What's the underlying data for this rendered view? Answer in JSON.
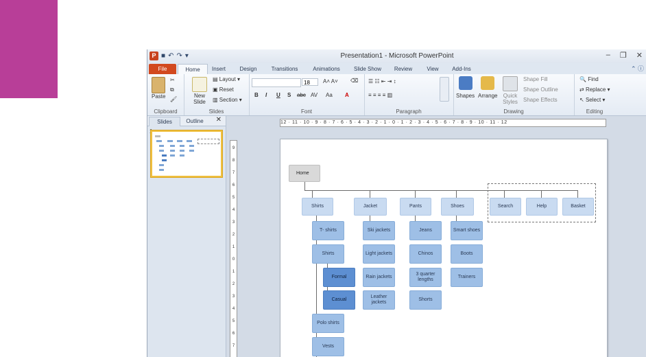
{
  "window": {
    "title": "Presentation1 - Microsoft PowerPoint",
    "logo": "P"
  },
  "tabs": [
    "File",
    "Home",
    "Insert",
    "Design",
    "Transitions",
    "Animations",
    "Slide Show",
    "Review",
    "View",
    "Add-Ins"
  ],
  "ribbon": {
    "clipboard": {
      "paste": "Paste",
      "label": "Clipboard"
    },
    "slides": {
      "new_slide": "New Slide",
      "layout": "Layout",
      "reset": "Reset",
      "section": "Section",
      "label": "Slides"
    },
    "font": {
      "size": "18",
      "bold": "B",
      "italic": "I",
      "underline": "U",
      "shadow": "S",
      "strike": "abc",
      "spacing": "AV",
      "case": "Aa",
      "color": "A",
      "label": "Font"
    },
    "paragraph": {
      "label": "Paragraph"
    },
    "drawing": {
      "shapes": "Shapes",
      "arrange": "Arrange",
      "quick_styles": "Quick Styles",
      "fill": "Shape Fill",
      "outline": "Shape Outline",
      "effects": "Shape Effects",
      "label": "Drawing"
    },
    "editing": {
      "find": "Find",
      "replace": "Replace",
      "select": "Select",
      "label": "Editing"
    }
  },
  "pane": {
    "tab_slides": "Slides",
    "tab_outline": "Outline",
    "close": "✕",
    "slide_number": "1"
  },
  "ruler": {
    "text": "12 · 11 · 10 · 9 · 8 · 7 · 6 · 5 · 4 · 3 · 2 · 1 · 0 · 1 · 2 · 3 · 4 · 5 · 6 · 7 · 8 · 9 · 10 · 11 · 12"
  },
  "vruler": [
    "9",
    "8",
    "7",
    "6",
    "5",
    "4",
    "3",
    "2",
    "1",
    "0",
    "1",
    "2",
    "3",
    "4",
    "5",
    "6",
    "7"
  ],
  "sitemap": {
    "home": "Home",
    "top": [
      "Shirts",
      "Jacket",
      "Pants",
      "Shoes",
      "Search",
      "Help",
      "Basket"
    ],
    "shirts_children": [
      "T- shirts",
      "Shirts",
      "Formal",
      "Casual",
      "Polo shirts",
      "Vests"
    ],
    "jacket_children": [
      "Ski jackets",
      "Light jackets",
      "Rain jackets",
      "Leather jackets"
    ],
    "pants_children": [
      "Jeans",
      "Chinos",
      "3 quarter lengths",
      "Shorts"
    ],
    "shoes_children": [
      "Smart shoes",
      "Boots",
      "Trainers"
    ]
  }
}
